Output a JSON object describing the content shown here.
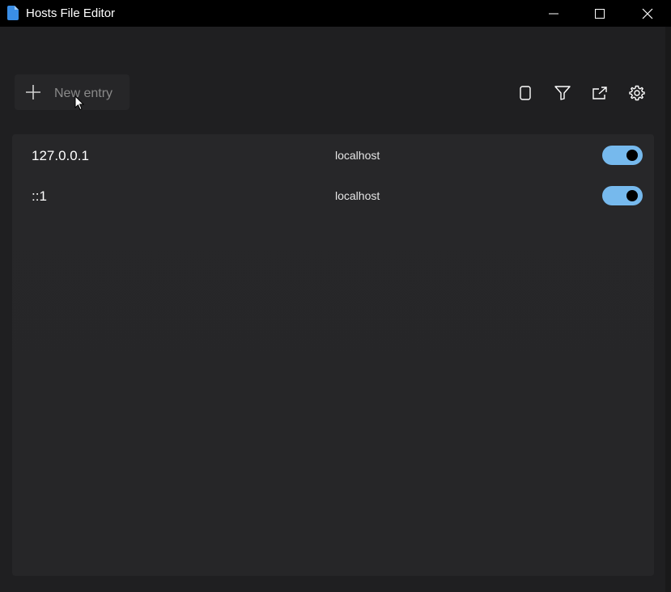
{
  "window": {
    "title": "Hosts File Editor",
    "app_icon": "document-icon",
    "controls": [
      "minimize-icon",
      "maximize-icon",
      "close-icon"
    ]
  },
  "toolbar": {
    "new_entry_label": "New entry",
    "new_entry_icon": "plus-icon",
    "actions": [
      "device-icon",
      "filter-icon",
      "open-external-icon",
      "gear-icon"
    ]
  },
  "entries": [
    {
      "address": "127.0.0.1",
      "host": "localhost",
      "active": true
    },
    {
      "address": "::1",
      "host": "localhost",
      "active": true
    }
  ],
  "colors": {
    "accent": "#76b9ed",
    "titlebar": "#000000",
    "background": "#1f1f21",
    "panel": "#272729",
    "app_icon": "#3a8ee6"
  }
}
